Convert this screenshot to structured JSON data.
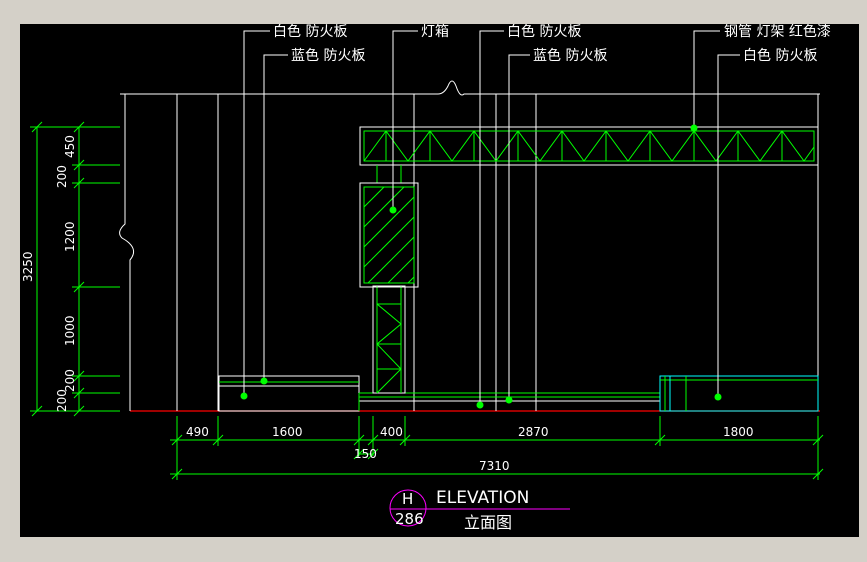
{
  "colors": {
    "background": "#000000",
    "frame": "#d4d0c8",
    "white": "#ffffff",
    "green": "#00ff00",
    "cyan": "#00ffff",
    "red": "#ff0000",
    "magenta": "#ff00ff"
  },
  "callouts": {
    "white_board_1": "白色 防火板",
    "blue_board_1": "蓝色 防火板",
    "light_box": "灯箱",
    "white_board_2": "白色 防火板",
    "blue_board_2": "蓝色 防火板",
    "truss": "钢管 灯架 红色漆",
    "white_board_3": "白色 防火板"
  },
  "dims_left": {
    "d450": "450",
    "d200a": "200",
    "d1200": "1200",
    "d1000": "1000",
    "d200b": "200",
    "d200c": "200",
    "total": "3250"
  },
  "dims_bottom": {
    "d490": "490",
    "d1600": "1600",
    "d150": "150",
    "d400": "400",
    "d2870": "2870",
    "d1800": "1800",
    "total": "7310"
  },
  "title_block": {
    "bubble_top": "H",
    "bubble_bottom": "286",
    "title_en": "ELEVATION",
    "title_cn": "立面图"
  }
}
